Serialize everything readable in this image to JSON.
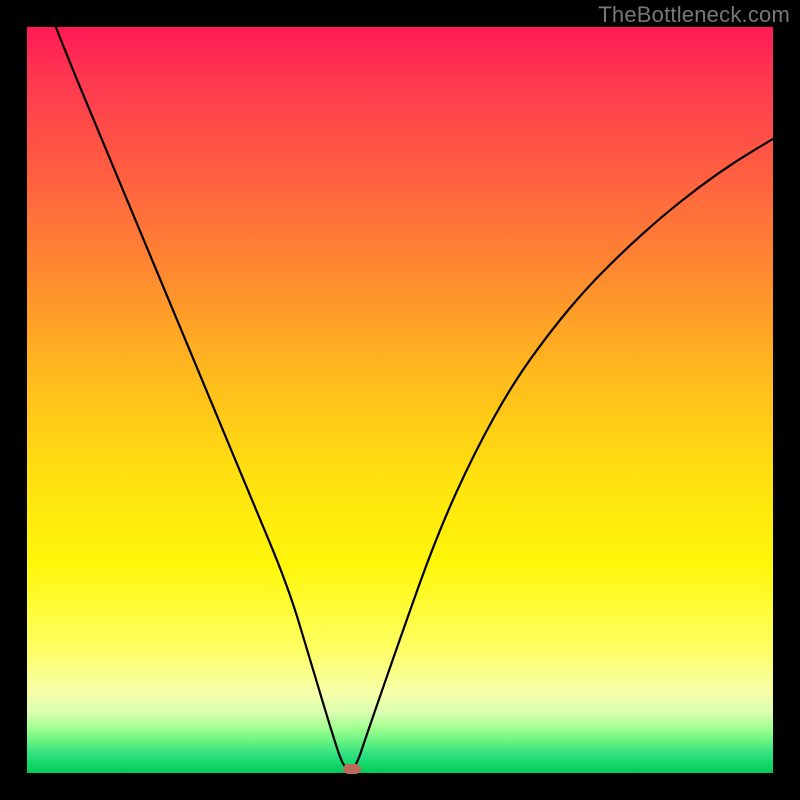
{
  "watermark": "TheBottleneck.com",
  "colors": {
    "frame": "#000000",
    "gradient_top": "#ff1a55",
    "gradient_bottom": "#08c85b",
    "curve": "#000000",
    "marker": "#bb6b5b"
  },
  "chart_data": {
    "type": "line",
    "title": "",
    "xlabel": "",
    "ylabel": "",
    "xlim": [
      0,
      100
    ],
    "ylim": [
      0,
      100
    ],
    "x": [
      0,
      5,
      10,
      15,
      20,
      25,
      30,
      35,
      38,
      41,
      42.5,
      44,
      45.5,
      50,
      55,
      60,
      65,
      70,
      75,
      80,
      85,
      90,
      95,
      100
    ],
    "values": [
      110,
      97,
      85,
      73,
      61,
      49,
      37,
      25,
      15,
      5,
      0.5,
      0.5,
      5,
      18,
      32,
      43,
      52,
      59,
      65,
      70,
      74.5,
      78.5,
      82,
      85
    ],
    "marker": {
      "x": 43.5,
      "y": 0.5,
      "color": "#bb6b5b"
    },
    "note": "Values are estimated from the unlabeled image; x and y are on a 0–100 percent-of-plot scale (0 at left/bottom)."
  }
}
